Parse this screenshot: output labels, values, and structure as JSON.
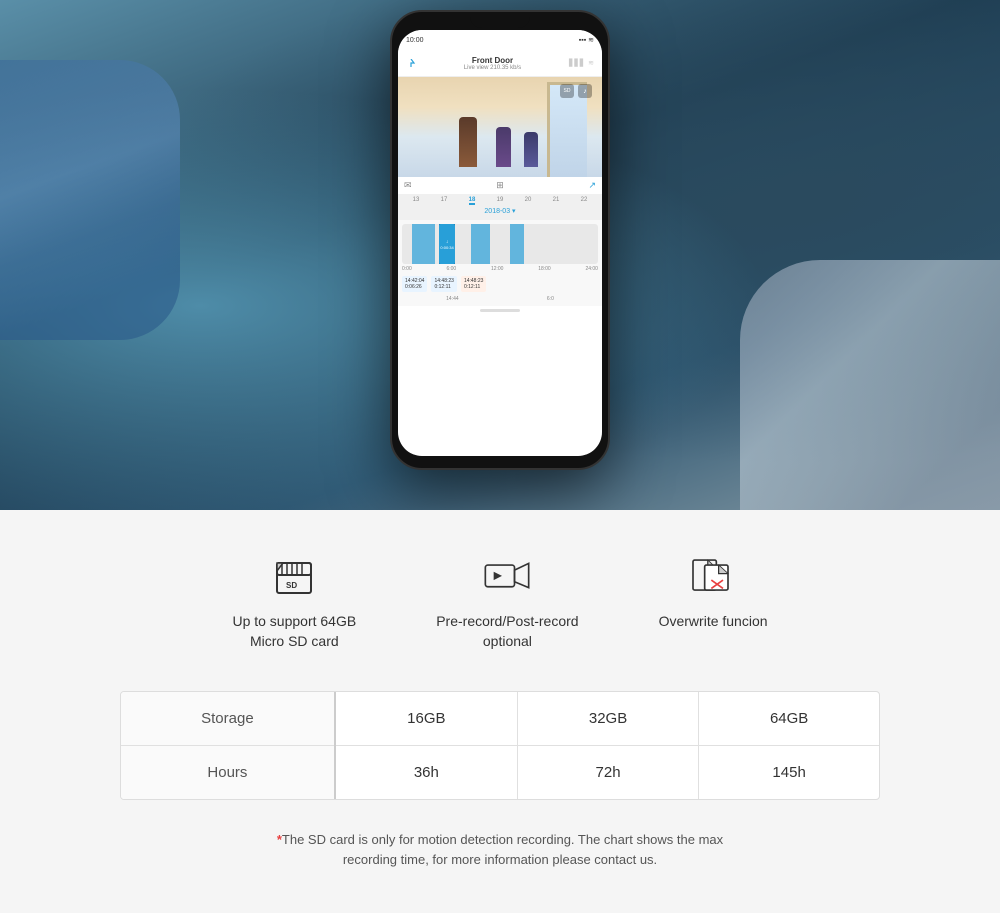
{
  "hero": {
    "phone": {
      "time": "10:00",
      "camera_label": "Front Door",
      "live_label": "Live view 210.35 kb/s",
      "date": "2018-03",
      "timeline_times": [
        "0:00",
        "6:00",
        "12:00",
        "18:00",
        "24:00"
      ],
      "timeline_dates": [
        "13",
        "17",
        "18",
        "19",
        "20",
        "21",
        "22"
      ]
    }
  },
  "features": {
    "items": [
      {
        "icon_name": "sd-card-icon",
        "text": "Up to support 64GB\nMicro SD card"
      },
      {
        "icon_name": "video-record-icon",
        "text": "Pre-record/Post-record\noptional"
      },
      {
        "icon_name": "overwrite-icon",
        "text": "Overwrite funcion"
      }
    ]
  },
  "storage_table": {
    "rows": [
      {
        "label": "Storage",
        "values": [
          "16GB",
          "32GB",
          "64GB"
        ]
      },
      {
        "label": "Hours",
        "values": [
          "36h",
          "72h",
          "145h"
        ]
      }
    ]
  },
  "disclaimer": {
    "asterisk": "*",
    "text": "The SD card is only for motion detection recording. The chart shows the max\nrecording time, for more information please contact us."
  }
}
